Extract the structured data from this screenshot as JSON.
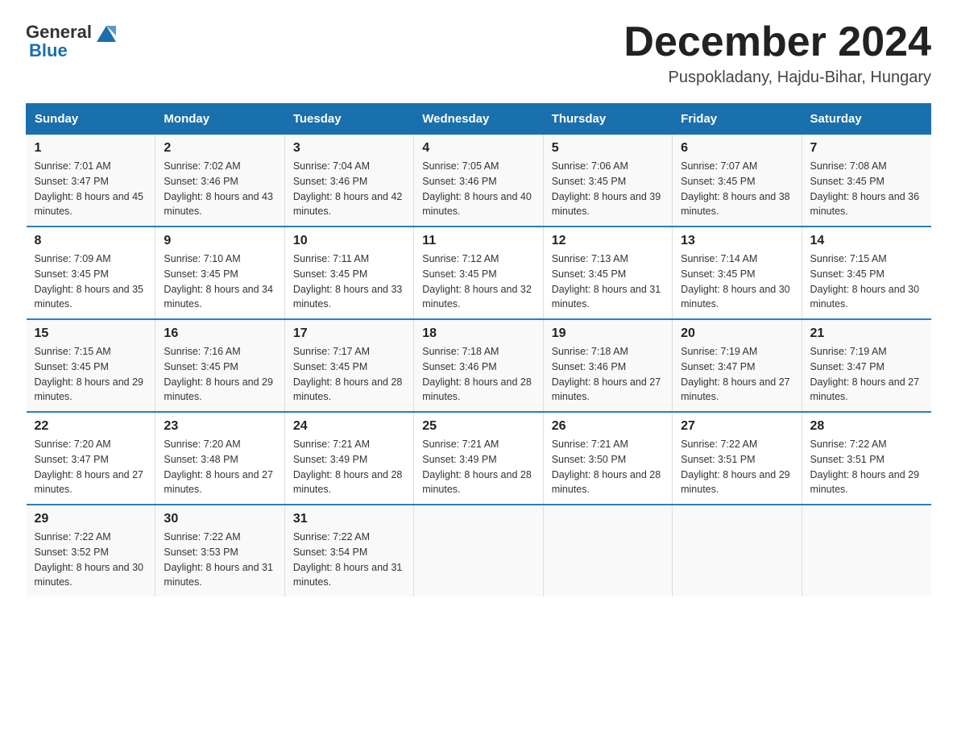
{
  "header": {
    "logo_general": "General",
    "logo_blue": "Blue",
    "month_title": "December 2024",
    "location": "Puspokladany, Hajdu-Bihar, Hungary"
  },
  "days_of_week": [
    "Sunday",
    "Monday",
    "Tuesday",
    "Wednesday",
    "Thursday",
    "Friday",
    "Saturday"
  ],
  "weeks": [
    [
      {
        "day": "1",
        "sunrise": "7:01 AM",
        "sunset": "3:47 PM",
        "daylight": "8 hours and 45 minutes."
      },
      {
        "day": "2",
        "sunrise": "7:02 AM",
        "sunset": "3:46 PM",
        "daylight": "8 hours and 43 minutes."
      },
      {
        "day": "3",
        "sunrise": "7:04 AM",
        "sunset": "3:46 PM",
        "daylight": "8 hours and 42 minutes."
      },
      {
        "day": "4",
        "sunrise": "7:05 AM",
        "sunset": "3:46 PM",
        "daylight": "8 hours and 40 minutes."
      },
      {
        "day": "5",
        "sunrise": "7:06 AM",
        "sunset": "3:45 PM",
        "daylight": "8 hours and 39 minutes."
      },
      {
        "day": "6",
        "sunrise": "7:07 AM",
        "sunset": "3:45 PM",
        "daylight": "8 hours and 38 minutes."
      },
      {
        "day": "7",
        "sunrise": "7:08 AM",
        "sunset": "3:45 PM",
        "daylight": "8 hours and 36 minutes."
      }
    ],
    [
      {
        "day": "8",
        "sunrise": "7:09 AM",
        "sunset": "3:45 PM",
        "daylight": "8 hours and 35 minutes."
      },
      {
        "day": "9",
        "sunrise": "7:10 AM",
        "sunset": "3:45 PM",
        "daylight": "8 hours and 34 minutes."
      },
      {
        "day": "10",
        "sunrise": "7:11 AM",
        "sunset": "3:45 PM",
        "daylight": "8 hours and 33 minutes."
      },
      {
        "day": "11",
        "sunrise": "7:12 AM",
        "sunset": "3:45 PM",
        "daylight": "8 hours and 32 minutes."
      },
      {
        "day": "12",
        "sunrise": "7:13 AM",
        "sunset": "3:45 PM",
        "daylight": "8 hours and 31 minutes."
      },
      {
        "day": "13",
        "sunrise": "7:14 AM",
        "sunset": "3:45 PM",
        "daylight": "8 hours and 30 minutes."
      },
      {
        "day": "14",
        "sunrise": "7:15 AM",
        "sunset": "3:45 PM",
        "daylight": "8 hours and 30 minutes."
      }
    ],
    [
      {
        "day": "15",
        "sunrise": "7:15 AM",
        "sunset": "3:45 PM",
        "daylight": "8 hours and 29 minutes."
      },
      {
        "day": "16",
        "sunrise": "7:16 AM",
        "sunset": "3:45 PM",
        "daylight": "8 hours and 29 minutes."
      },
      {
        "day": "17",
        "sunrise": "7:17 AM",
        "sunset": "3:45 PM",
        "daylight": "8 hours and 28 minutes."
      },
      {
        "day": "18",
        "sunrise": "7:18 AM",
        "sunset": "3:46 PM",
        "daylight": "8 hours and 28 minutes."
      },
      {
        "day": "19",
        "sunrise": "7:18 AM",
        "sunset": "3:46 PM",
        "daylight": "8 hours and 27 minutes."
      },
      {
        "day": "20",
        "sunrise": "7:19 AM",
        "sunset": "3:47 PM",
        "daylight": "8 hours and 27 minutes."
      },
      {
        "day": "21",
        "sunrise": "7:19 AM",
        "sunset": "3:47 PM",
        "daylight": "8 hours and 27 minutes."
      }
    ],
    [
      {
        "day": "22",
        "sunrise": "7:20 AM",
        "sunset": "3:47 PM",
        "daylight": "8 hours and 27 minutes."
      },
      {
        "day": "23",
        "sunrise": "7:20 AM",
        "sunset": "3:48 PM",
        "daylight": "8 hours and 27 minutes."
      },
      {
        "day": "24",
        "sunrise": "7:21 AM",
        "sunset": "3:49 PM",
        "daylight": "8 hours and 28 minutes."
      },
      {
        "day": "25",
        "sunrise": "7:21 AM",
        "sunset": "3:49 PM",
        "daylight": "8 hours and 28 minutes."
      },
      {
        "day": "26",
        "sunrise": "7:21 AM",
        "sunset": "3:50 PM",
        "daylight": "8 hours and 28 minutes."
      },
      {
        "day": "27",
        "sunrise": "7:22 AM",
        "sunset": "3:51 PM",
        "daylight": "8 hours and 29 minutes."
      },
      {
        "day": "28",
        "sunrise": "7:22 AM",
        "sunset": "3:51 PM",
        "daylight": "8 hours and 29 minutes."
      }
    ],
    [
      {
        "day": "29",
        "sunrise": "7:22 AM",
        "sunset": "3:52 PM",
        "daylight": "8 hours and 30 minutes."
      },
      {
        "day": "30",
        "sunrise": "7:22 AM",
        "sunset": "3:53 PM",
        "daylight": "8 hours and 31 minutes."
      },
      {
        "day": "31",
        "sunrise": "7:22 AM",
        "sunset": "3:54 PM",
        "daylight": "8 hours and 31 minutes."
      },
      {
        "day": "",
        "sunrise": "",
        "sunset": "",
        "daylight": ""
      },
      {
        "day": "",
        "sunrise": "",
        "sunset": "",
        "daylight": ""
      },
      {
        "day": "",
        "sunrise": "",
        "sunset": "",
        "daylight": ""
      },
      {
        "day": "",
        "sunrise": "",
        "sunset": "",
        "daylight": ""
      }
    ]
  ],
  "labels": {
    "sunrise": "Sunrise: ",
    "sunset": "Sunset: ",
    "daylight": "Daylight: "
  }
}
